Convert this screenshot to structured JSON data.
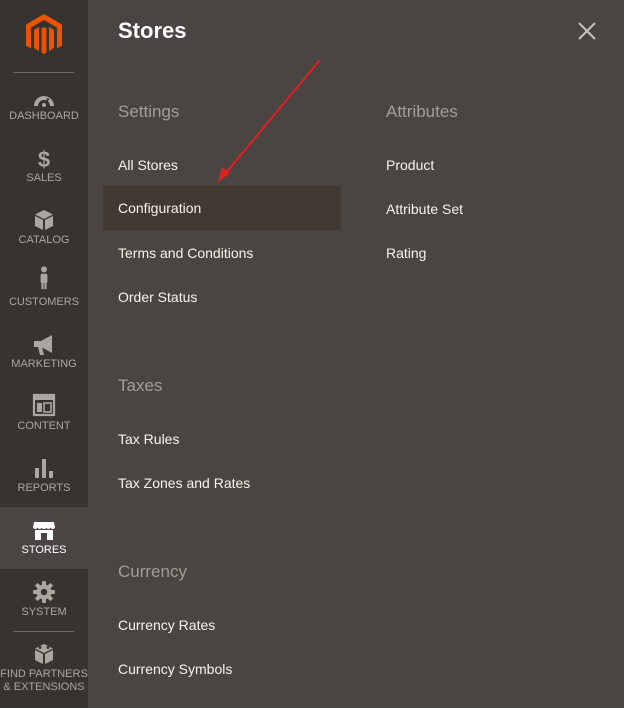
{
  "sidebar": {
    "items": [
      {
        "label": "DASHBOARD",
        "icon": "dashboard-icon"
      },
      {
        "label": "SALES",
        "icon": "dollar-icon"
      },
      {
        "label": "CATALOG",
        "icon": "box-icon"
      },
      {
        "label": "CUSTOMERS",
        "icon": "person-icon"
      },
      {
        "label": "MARKETING",
        "icon": "megaphone-icon"
      },
      {
        "label": "CONTENT",
        "icon": "layout-icon"
      },
      {
        "label": "REPORTS",
        "icon": "bar-chart-icon"
      },
      {
        "label": "STORES",
        "icon": "storefront-icon"
      },
      {
        "label": "SYSTEM",
        "icon": "gear-icon"
      },
      {
        "label_line1": "FIND PARTNERS",
        "label_line2": "& EXTENSIONS",
        "icon": "blocks-icon"
      }
    ],
    "active": "STORES"
  },
  "panel": {
    "title": "Stores",
    "close_icon": "close-icon",
    "settings": {
      "title": "Settings",
      "links": [
        "All Stores",
        "Configuration",
        "Terms and Conditions",
        "Order Status"
      ],
      "selected": "Configuration"
    },
    "taxes": {
      "title": "Taxes",
      "links": [
        "Tax Rules",
        "Tax Zones and Rates"
      ]
    },
    "currency": {
      "title": "Currency",
      "links": [
        "Currency Rates",
        "Currency Symbols"
      ]
    },
    "attributes": {
      "title": "Attributes",
      "links": [
        "Product",
        "Attribute Set",
        "Rating"
      ]
    }
  },
  "colors": {
    "sidebar_bg": "#373330",
    "panel_bg": "#4a4542",
    "logo_orange": "#eb5202",
    "selected_bg": "#403934",
    "arrow_red": "#e02020"
  }
}
